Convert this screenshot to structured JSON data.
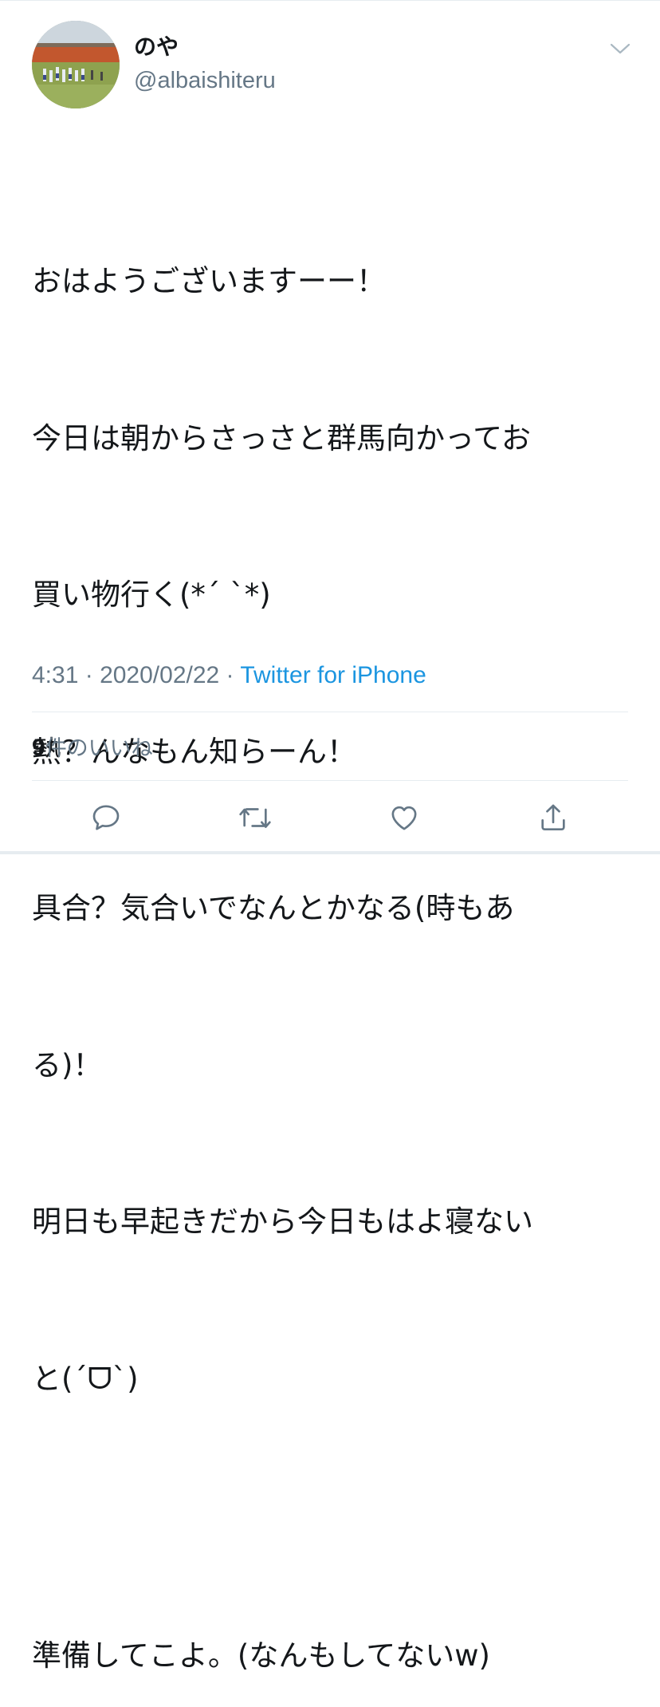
{
  "user": {
    "display_name": "のや",
    "handle": "@albaishiteru"
  },
  "tweet": {
    "lines": [
      "おはようございますーー！",
      "今日は朝からさっさと群馬向かってお",
      "買い物行く(*´ `*)",
      "熱？んなもん知らーん！",
      "具合？気合いでなんとかなる(時もあ",
      "る)！",
      "明日も早起きだから今日もはよ寝ない",
      "と(´ᗜ`)",
      "準備してこよ。(なんもしてないw)"
    ]
  },
  "meta": {
    "time": "4:31",
    "separator": " · ",
    "date": "2020/02/22",
    "source": "Twitter for iPhone"
  },
  "likes": {
    "count": "9",
    "label": "件のいいね"
  },
  "icons": {
    "caret": "chevron-down-icon",
    "reply": "reply-icon",
    "retweet": "retweet-icon",
    "like": "heart-icon",
    "share": "share-icon"
  },
  "colors": {
    "text": "#14171a",
    "secondary": "#657786",
    "link": "#1b95e0",
    "divider": "#e6ecf0"
  }
}
